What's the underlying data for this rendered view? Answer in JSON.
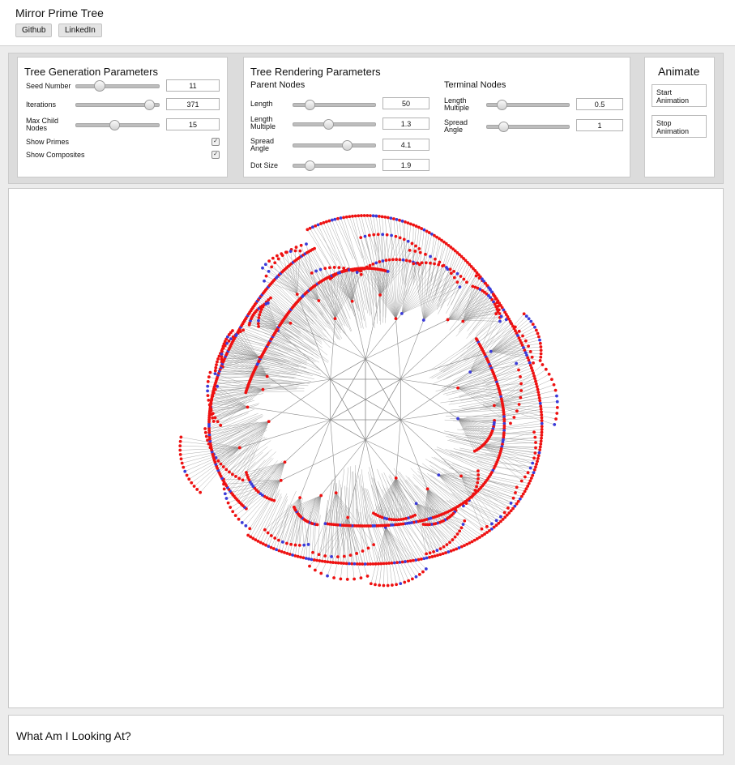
{
  "app": {
    "title": "Mirror Prime Tree",
    "links": [
      "Github",
      "LinkedIn"
    ]
  },
  "tree_generation": {
    "title": "Tree Generation Parameters",
    "seed_label": "Seed Number",
    "seed_value": "11",
    "iterations_label": "Iterations",
    "iterations_value": "371",
    "max_child_label": "Max Child Nodes",
    "max_child_value": "15",
    "show_primes_label": "Show Primes",
    "show_primes_checked": true,
    "show_composites_label": "Show Composites",
    "show_composites_checked": true,
    "slider_levels": {
      "seed": 0.28,
      "iterations": 0.88,
      "max_child": 0.47
    }
  },
  "tree_rendering": {
    "title": "Tree Rendering Parameters",
    "parent_title": "Parent Nodes",
    "terminal_title": "Terminal Nodes",
    "length_label": "Length",
    "length_value": "50",
    "length_multiple_label": "Length Multiple",
    "length_multiple_value": "1.3",
    "spread_angle_label": "Spread Angle",
    "spread_angle_value": "4.1",
    "dot_size_label": "Dot Size",
    "dot_size_value": "1.9",
    "term_length_multiple_label": "Length Multiple",
    "term_length_multiple_value": "0.5",
    "term_spread_angle_label": "Spread Angle",
    "term_spread_angle_value": "1",
    "slider_levels": {
      "length": 0.19,
      "length_multiple": 0.42,
      "spread_angle": 0.65,
      "dot_size": 0.19,
      "term_length_multiple": 0.17,
      "term_spread_angle": 0.19
    }
  },
  "animate": {
    "title": "Animate",
    "start_label": "Start Animation",
    "stop_label": "Stop Animation"
  },
  "info": {
    "title": "What Am I Looking At?"
  },
  "colors": {
    "prime": "#3b3bd8",
    "composite": "#ee1111",
    "edge": "#8a8a8a"
  }
}
